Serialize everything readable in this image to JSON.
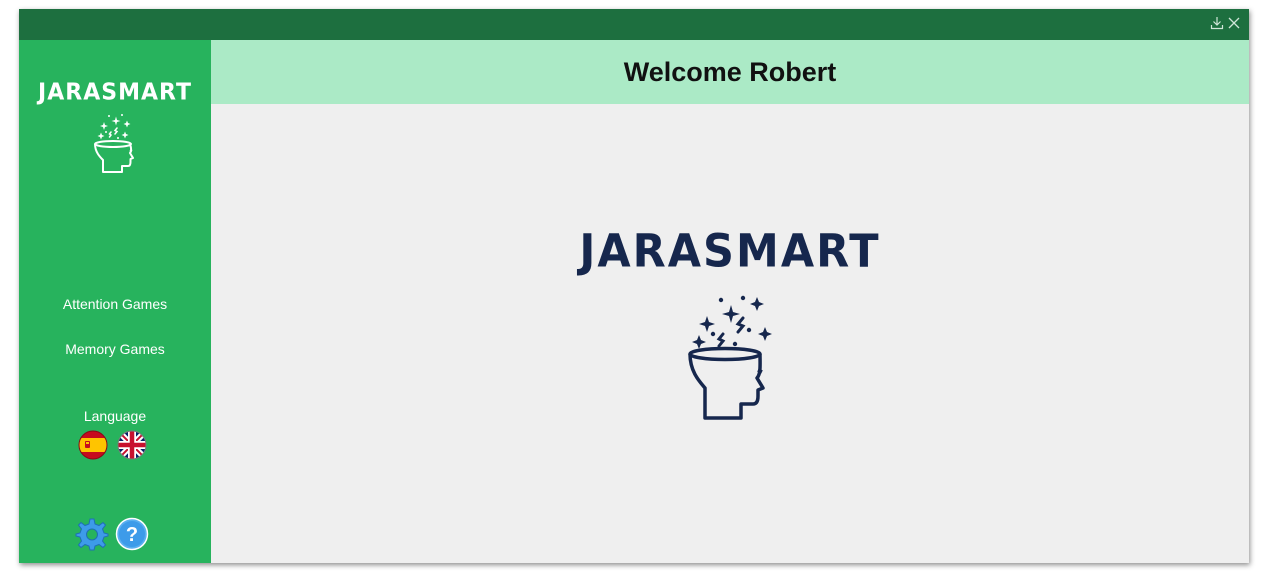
{
  "window": {
    "controls": [
      {
        "icon": "download-icon"
      },
      {
        "icon": "close-icon"
      }
    ]
  },
  "sidebar": {
    "brand": "JARASMART",
    "nav": [
      {
        "label": "Attention Games"
      },
      {
        "label": "Memory Games"
      }
    ],
    "language_label": "Language",
    "flags": [
      {
        "icon": "spain-flag-icon"
      },
      {
        "icon": "uk-flag-icon"
      }
    ],
    "bottom_icons": [
      {
        "icon": "settings-gear-icon"
      },
      {
        "icon": "help-icon"
      }
    ]
  },
  "header": {
    "title": "Welcome Robert"
  },
  "main": {
    "logo_text": "JARASMART"
  },
  "colors": {
    "titlebar": "#1d6f3f",
    "sidebar": "#27b35d",
    "header": "#abeac6",
    "content_bg": "#efefef",
    "logo_navy": "#16274d",
    "icon_blue": "#3d9be9"
  }
}
